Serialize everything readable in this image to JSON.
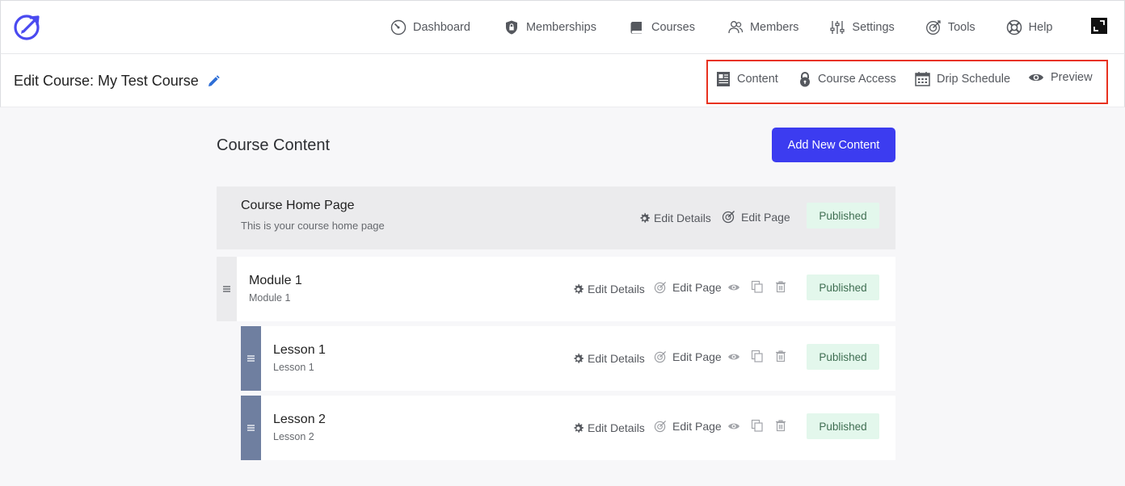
{
  "nav": {
    "items": [
      {
        "label": "Dashboard",
        "icon": "dashboard-gauge-icon"
      },
      {
        "label": "Memberships",
        "icon": "shield-lock-icon"
      },
      {
        "label": "Courses",
        "icon": "book-icon"
      },
      {
        "label": "Members",
        "icon": "users-icon"
      },
      {
        "label": "Settings",
        "icon": "sliders-icon"
      },
      {
        "label": "Tools",
        "icon": "target-icon"
      },
      {
        "label": "Help",
        "icon": "lifebuoy-icon"
      }
    ]
  },
  "subheader": {
    "title": "Edit Course: My Test Course",
    "tabs": [
      {
        "label": "Content",
        "icon": "content-doc-icon"
      },
      {
        "label": "Course Access",
        "icon": "lock-icon"
      },
      {
        "label": "Drip Schedule",
        "icon": "calendar-icon"
      },
      {
        "label": "Preview",
        "icon": "eye-icon"
      }
    ]
  },
  "content": {
    "title": "Course Content",
    "add_button": "Add New Content",
    "home": {
      "name": "Course Home Page",
      "description": "This is your course home page",
      "edit_details": "Edit Details",
      "edit_page": "Edit Page",
      "status": "Published"
    },
    "items": [
      {
        "name": "Module 1",
        "description": "Module 1",
        "edit_details": "Edit Details",
        "edit_page": "Edit Page",
        "status": "Published"
      },
      {
        "name": "Lesson 1",
        "description": "Lesson 1",
        "edit_details": "Edit Details",
        "edit_page": "Edit Page",
        "status": "Published"
      },
      {
        "name": "Lesson 2",
        "description": "Lesson 2",
        "edit_details": "Edit Details",
        "edit_page": "Edit Page",
        "status": "Published"
      }
    ]
  },
  "colors": {
    "accent": "#3c3cf0",
    "highlight_border": "#e8321f",
    "published_bg": "#e3f7ec",
    "lesson_handle": "#6f7fa0"
  }
}
